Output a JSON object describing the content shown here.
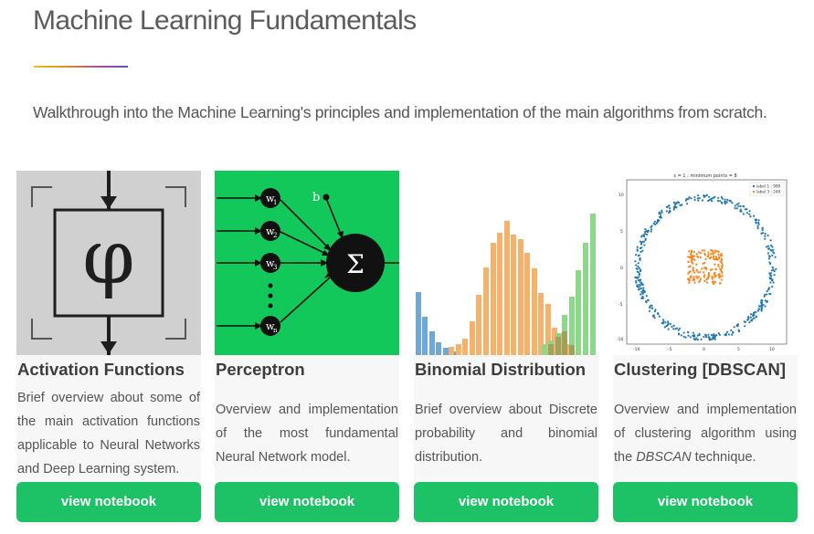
{
  "header": {
    "title": "Machine Learning Fundamentals",
    "subtitle": "Walkthrough into the Machine Learning's principles and implementation of the main algorithms from scratch."
  },
  "colors": {
    "accent_green": "#1ec266",
    "card_bg": "#f7f7f7"
  },
  "cards": [
    {
      "title": "Activation Functions",
      "description": "Brief overview about some of the main activation functions applicable to Neural Networks and Deep Learning system.",
      "button": "view notebook",
      "image": {
        "icon": "phi-function-icon",
        "symbol": "φ"
      }
    },
    {
      "title": "Perceptron",
      "description": "Overview and implementation of the most fundamental Neural Network model.",
      "button": "view notebook",
      "image": {
        "icon": "perceptron-diagram-icon",
        "bias": "b",
        "sum": "Σ",
        "weights": [
          "w1",
          "w2",
          "w3",
          "wn"
        ]
      }
    },
    {
      "title": "Binomial Distribution",
      "description": "Brief overview about Discrete probability and binomial distribution.",
      "button": "view notebook",
      "image": {
        "icon": "histogram-icon"
      }
    },
    {
      "title": "Clustering [DBSCAN]",
      "description_before": "Overview and implementation of clustering algorithm using the ",
      "description_em": "DBSCAN",
      "description_after": " technique.",
      "button": "view notebook",
      "image": {
        "icon": "scatter-clusters-icon",
        "plot_title": "ε = 1 ; minimum points = 8",
        "legend": [
          "label 1 : 999",
          "label 3 : 249"
        ],
        "yticks": [
          "10",
          "5",
          "0",
          "-5",
          "-10"
        ],
        "xticks": [
          "-10",
          "-5",
          "0",
          "5",
          "10"
        ]
      }
    }
  ]
}
